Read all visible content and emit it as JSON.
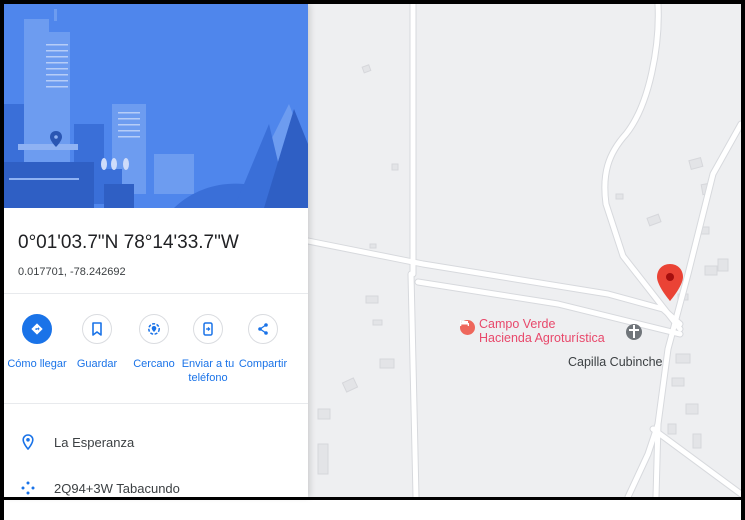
{
  "place": {
    "title": "0°01'03.7\"N 78°14'33.7\"W",
    "decimal": "0.017701, -78.242692"
  },
  "actions": [
    {
      "label": "Cómo llegar",
      "icon": "directions-icon"
    },
    {
      "label": "Guardar",
      "icon": "bookmark-icon"
    },
    {
      "label": "Cercano",
      "icon": "nearby-icon"
    },
    {
      "label": "Enviar a tu teléfono",
      "icon": "send-to-phone-icon"
    },
    {
      "label": "Compartir",
      "icon": "share-icon"
    }
  ],
  "info": {
    "locality": "La Esperanza",
    "plus_code": "2Q94+3W Tabacundo"
  },
  "map": {
    "poi_label_line1": "Campo Verde",
    "poi_label_line2": "Hacienda Agroturística",
    "chapel_label": "Capilla Cubinche",
    "pin": {
      "lat": 0.017701,
      "lon": -78.242692
    }
  },
  "colors": {
    "accent": "#1a73e8",
    "hero_blue": "#4f86ec",
    "poi_pink": "#e8486b",
    "pin_red": "#ea4335",
    "map_bg": "#eeeff1"
  }
}
